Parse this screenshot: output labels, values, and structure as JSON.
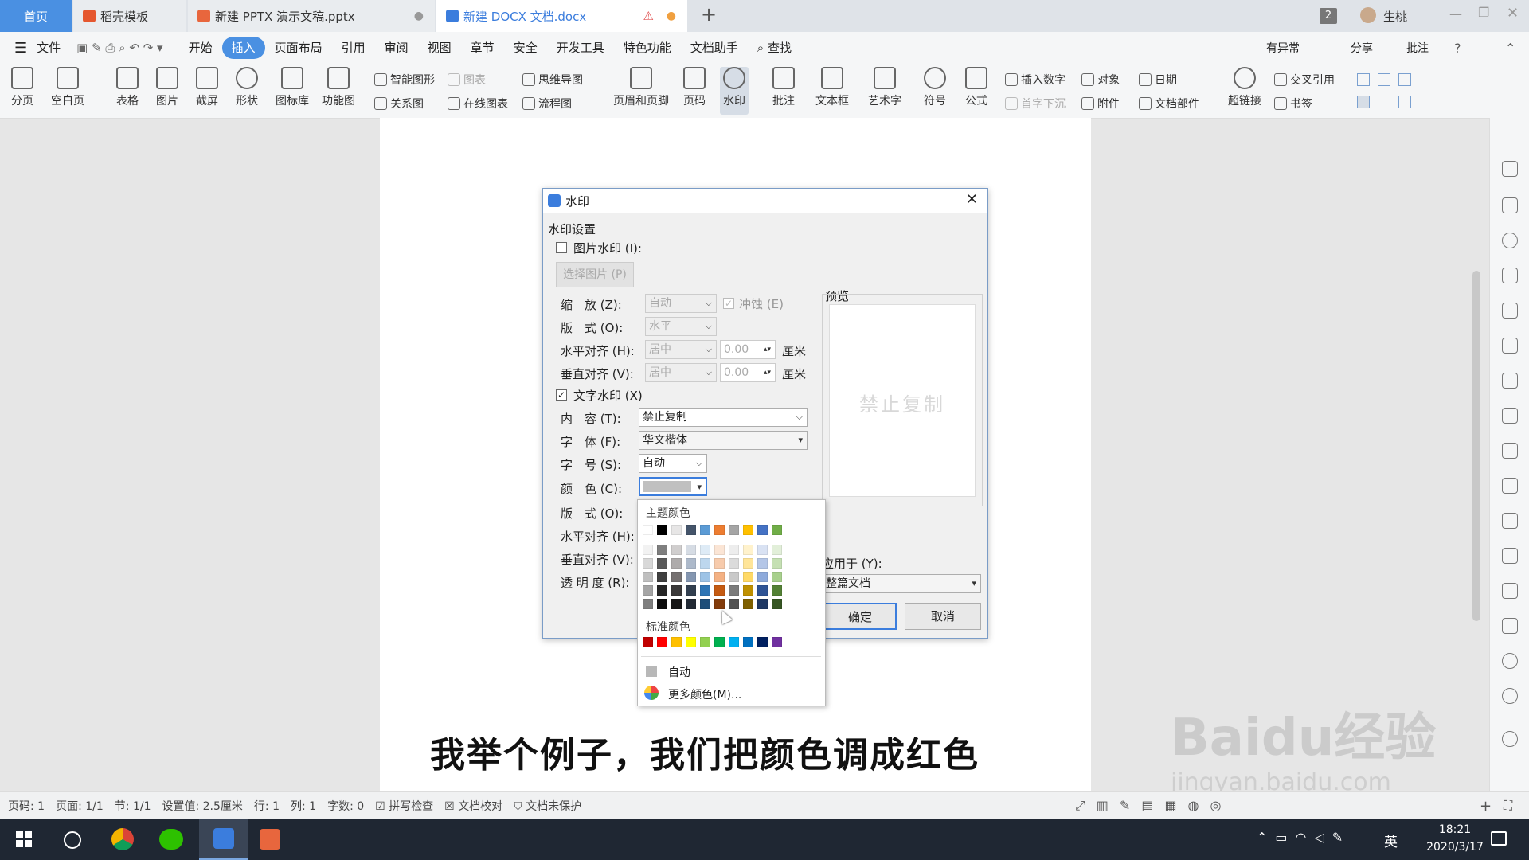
{
  "tabs": {
    "home": "首页",
    "docer": "稻壳模板",
    "pptx": "新建 PPTX 演示文稿.pptx",
    "docx": "新建 DOCX 文档.docx",
    "add": "+",
    "badge": "2",
    "user": "生桃"
  },
  "menu": {
    "file": "文件",
    "items": [
      "开始",
      "插入",
      "页面布局",
      "引用",
      "审阅",
      "视图",
      "章节",
      "安全",
      "开发工具",
      "特色功能",
      "文档助手"
    ],
    "find": "查找",
    "right": [
      "有异常",
      "分享",
      "批注"
    ]
  },
  "ribbon": {
    "big": [
      "分页",
      "空白页",
      "表格",
      "图片",
      "截屏",
      "形状",
      "图标库",
      "功能图",
      "页眉和页脚",
      "页码",
      "水印",
      "批注",
      "文本框",
      "艺术字",
      "符号",
      "公式",
      "超链接"
    ],
    "small": {
      "smart_art": "智能图形",
      "chart": "图表",
      "mindmap": "思维导图",
      "relation": "关系图",
      "online_chart": "在线图表",
      "flowchart": "流程图",
      "insert_number": "插入数字",
      "object": "对象",
      "date": "日期",
      "dropcap": "首字下沉",
      "attachment": "附件",
      "docpart": "文档部件",
      "crossref": "交叉引用",
      "bookmark": "书签"
    }
  },
  "dialog": {
    "title": "水印",
    "group": "水印设置",
    "image_wm": "图片水印 (I):",
    "select_image": "选择图片 (P)",
    "scale_label": "缩　放 (Z):",
    "scale_value": "自动",
    "washout": "冲蚀 (E)",
    "layout_label": "版　式 (O):",
    "layout_value": "水平",
    "halign_label": "水平对齐 (H):",
    "halign_value": "居中",
    "halign_num": "0.00",
    "valign_label": "垂直对齐 (V):",
    "valign_value": "居中",
    "valign_num": "0.00",
    "unit": "厘米",
    "text_wm": "文字水印 (X)",
    "content_label": "内　容 (T):",
    "content_value": "禁止复制",
    "font_label": "字　体 (F):",
    "font_value": "华文楷体",
    "size_label": "字　号 (S):",
    "size_value": "自动",
    "color_label": "颜　色 (C):",
    "layout2_label": "版　式 (O):",
    "halign2_label": "水平对齐 (H):",
    "valign2_label": "垂直对齐 (V):",
    "transparency_label": "透 明 度 (R):",
    "preview_label": "预览",
    "preview_text": "禁止复制",
    "apply_label": "应用于 (Y):",
    "apply_value": "整篇文档",
    "ok": "确定",
    "cancel": "取消"
  },
  "palette": {
    "theme_label": "主题颜色",
    "standard_label": "标准颜色",
    "auto": "自动",
    "more": "更多颜色(M)...",
    "theme_top": [
      "#ffffff",
      "#000000",
      "#e7e6e6",
      "#44546a",
      "#5b9bd5",
      "#ed7d31",
      "#a5a5a5",
      "#ffc000",
      "#4472c4",
      "#70ad47"
    ],
    "theme_shades": [
      [
        "#f2f2f2",
        "#7f7f7f",
        "#d0cece",
        "#d6dce4",
        "#deebf6",
        "#fbe5d5",
        "#ededed",
        "#fff2cc",
        "#d9e2f3",
        "#e2efd9"
      ],
      [
        "#d8d8d8",
        "#595959",
        "#aeabab",
        "#adb9ca",
        "#bdd7ee",
        "#f7cbac",
        "#dbdbdb",
        "#ffe599",
        "#b4c6e7",
        "#c5e0b3"
      ],
      [
        "#bfbfbf",
        "#3f3f3f",
        "#757070",
        "#8496b0",
        "#9dc3e6",
        "#f4b183",
        "#c9c9c9",
        "#ffd966",
        "#8eaadb",
        "#a8d08d"
      ],
      [
        "#a5a5a5",
        "#262626",
        "#3a3838",
        "#323f4f",
        "#2e75b5",
        "#c55a11",
        "#7b7b7b",
        "#bf9000",
        "#2f5496",
        "#538135"
      ],
      [
        "#7f7f7f",
        "#0c0c0c",
        "#171616",
        "#222a35",
        "#1e4e79",
        "#833c0b",
        "#525252",
        "#7f6000",
        "#1f3864",
        "#375623"
      ]
    ],
    "standard": [
      "#c00000",
      "#ff0000",
      "#ffc000",
      "#ffff00",
      "#92d050",
      "#00b050",
      "#00b0f0",
      "#0070c0",
      "#002060",
      "#7030a0"
    ]
  },
  "subtitle": "我举个例子，我们把颜色调成红色",
  "status": [
    "页码: 1",
    "页面: 1/1",
    "节: 1/1",
    "设置值: 2.5厘米",
    "行: 1",
    "列: 1",
    "字数: 0",
    "拼写检查",
    "文档校对",
    "文档未保护"
  ],
  "taskbar": {
    "lang": "英",
    "time": "18:21",
    "date": "2020/3/17"
  },
  "watermark": {
    "brand": "Baidu经验",
    "url": "jingyan.baidu.com"
  }
}
